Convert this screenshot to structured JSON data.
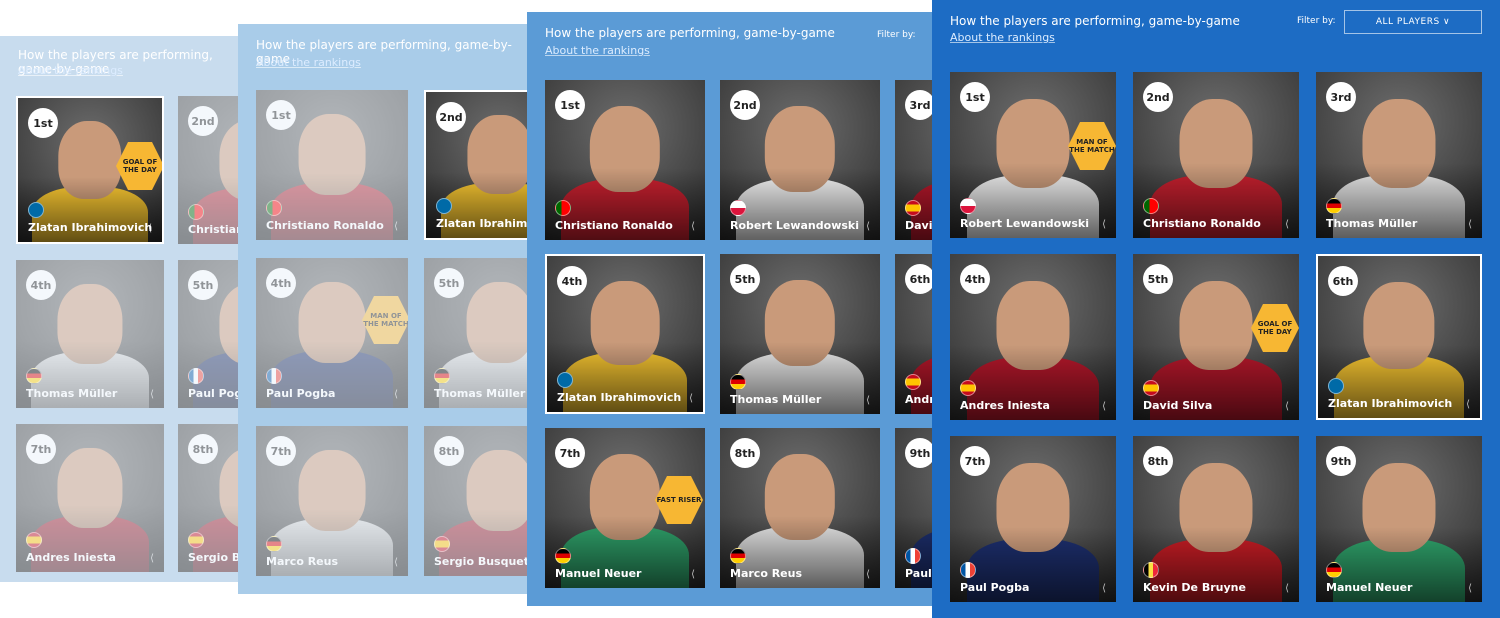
{
  "header": {
    "title": "How the players are performing, game-by-game",
    "subtitle": "About the rankings",
    "filter_label": "Filter by:",
    "filter_value": "ALL PLAYERS ∨"
  },
  "share_icon": "share-icon",
  "colors": {
    "badge": "#f7b733",
    "panel1_bg": "#c8dcee",
    "panel2_bg": "#a9cce9",
    "panel3_bg": "#5b9bd6",
    "panel4_bg": "#1d6cc4"
  },
  "panels": [
    {
      "cards": [
        {
          "rank": "1st",
          "name": "Zlatan Ibrahimovich",
          "badge": "GOAL OF THE DAY"
        },
        {
          "rank": "2nd",
          "name": "Christiano Ronaldo"
        },
        {
          "rank": "4th",
          "name": "Thomas Müller"
        },
        {
          "rank": "5th",
          "name": "Paul Pogba"
        },
        {
          "rank": "7th",
          "name": "Andres Iniesta"
        },
        {
          "rank": "8th",
          "name": "Sergio Busquets"
        }
      ]
    },
    {
      "cards": [
        {
          "rank": "1st",
          "name": "Christiano Ronaldo"
        },
        {
          "rank": "2nd",
          "name": "Zlatan Ibrahimovich"
        },
        {
          "rank": "4th",
          "name": "Paul Pogba",
          "badge": "MAN OF THE MATCH"
        },
        {
          "rank": "5th",
          "name": "Thomas Müller"
        },
        {
          "rank": "7th",
          "name": "Marco Reus"
        },
        {
          "rank": "8th",
          "name": "Sergio Busquets"
        }
      ]
    },
    {
      "cards": [
        {
          "rank": "1st",
          "name": "Christiano Ronaldo"
        },
        {
          "rank": "2nd",
          "name": "Robert Lewandowski"
        },
        {
          "rank": "3rd",
          "name": "David Silva"
        },
        {
          "rank": "4th",
          "name": "Zlatan Ibrahimovich"
        },
        {
          "rank": "5th",
          "name": "Thomas Müller"
        },
        {
          "rank": "6th",
          "name": "Andres Iniesta"
        },
        {
          "rank": "7th",
          "name": "Manuel Neuer",
          "badge": "FAST RISER"
        },
        {
          "rank": "8th",
          "name": "Marco Reus"
        },
        {
          "rank": "9th",
          "name": "Paul Pogba"
        }
      ]
    },
    {
      "cards": [
        {
          "rank": "1st",
          "name": "Robert Lewandowski",
          "badge": "MAN OF THE MATCH"
        },
        {
          "rank": "2nd",
          "name": "Christiano Ronaldo"
        },
        {
          "rank": "3rd",
          "name": "Thomas Müller"
        },
        {
          "rank": "4th",
          "name": "Andres Iniesta"
        },
        {
          "rank": "5th",
          "name": "David Silva",
          "badge": "GOAL OF THE DAY"
        },
        {
          "rank": "6th",
          "name": "Zlatan Ibrahimovich"
        },
        {
          "rank": "7th",
          "name": "Paul Pogba"
        },
        {
          "rank": "8th",
          "name": "Kevin De Bruyne"
        },
        {
          "rank": "9th",
          "name": "Manuel Neuer"
        }
      ]
    }
  ]
}
